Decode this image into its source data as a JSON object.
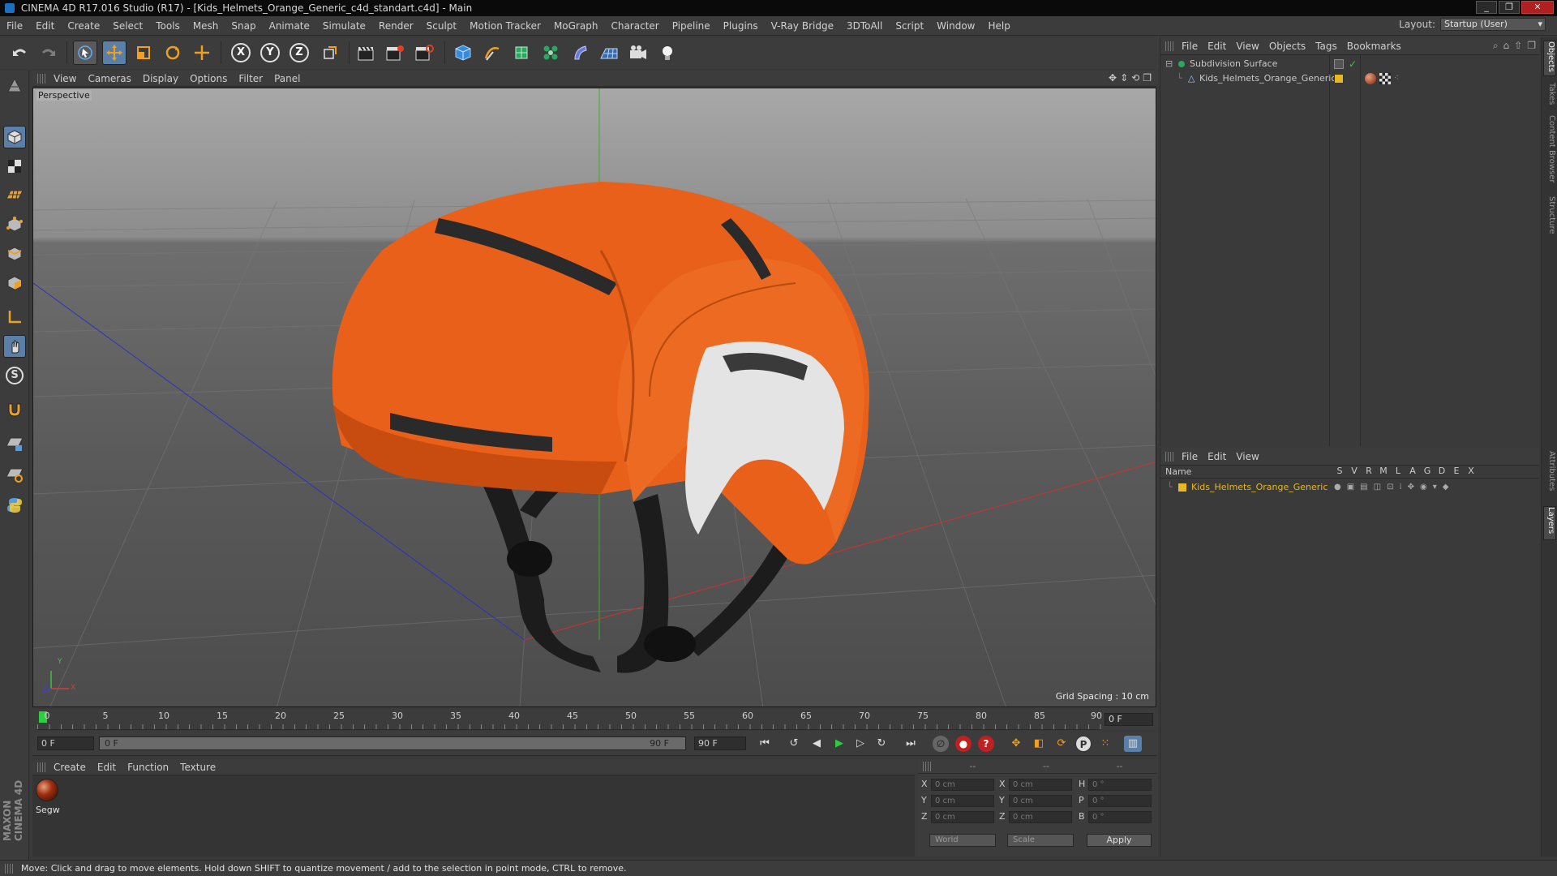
{
  "window": {
    "title": "CINEMA 4D R17.016 Studio (R17) - [Kids_Helmets_Orange_Generic_c4d_standart.c4d] - Main",
    "minimize": "_",
    "restore": "❐",
    "close": "✕"
  },
  "menu": {
    "items": [
      "File",
      "Edit",
      "Create",
      "Select",
      "Tools",
      "Mesh",
      "Snap",
      "Animate",
      "Simulate",
      "Render",
      "Sculpt",
      "Motion Tracker",
      "MoGraph",
      "Character",
      "Pipeline",
      "Plugins",
      "V-Ray Bridge",
      "3DToAll",
      "Script",
      "Window",
      "Help"
    ],
    "layout_label": "Layout:",
    "layout_value": "Startup (User)"
  },
  "toolbar": {
    "axis_x": "X",
    "axis_y": "Y",
    "axis_z": "Z"
  },
  "left_toolbar": {
    "sculpt_s": "S"
  },
  "branding": {
    "logo_text": "MAXON CINEMA 4D"
  },
  "viewport": {
    "menu": [
      "View",
      "Cameras",
      "Display",
      "Options",
      "Filter",
      "Panel"
    ],
    "label": "Perspective",
    "grid_spacing": "Grid Spacing : 10 cm",
    "axis_y": "Y",
    "axis_x": "X",
    "axis_z": "Z"
  },
  "timeline": {
    "ticks": [
      "0",
      "5",
      "10",
      "15",
      "20",
      "25",
      "30",
      "35",
      "40",
      "45",
      "50",
      "55",
      "60",
      "65",
      "70",
      "75",
      "80",
      "85",
      "90"
    ],
    "current_frame": "0 F"
  },
  "transport": {
    "start_field": "0 F",
    "range_start": "0 F",
    "range_end": "90 F",
    "end_field": "90 F"
  },
  "materials": {
    "menu": [
      "Create",
      "Edit",
      "Function",
      "Texture"
    ],
    "items": [
      {
        "name": "Segw"
      }
    ]
  },
  "coordinates": {
    "headers": [
      "--",
      "--",
      "--"
    ],
    "rows": [
      {
        "a": "X",
        "av": "0 cm",
        "b": "X",
        "bv": "0 cm",
        "c": "H",
        "cv": "0 °"
      },
      {
        "a": "Y",
        "av": "0 cm",
        "b": "Y",
        "bv": "0 cm",
        "c": "P",
        "cv": "0 °"
      },
      {
        "a": "Z",
        "av": "0 cm",
        "b": "Z",
        "bv": "0 cm",
        "c": "B",
        "cv": "0 °"
      }
    ],
    "space": "World",
    "mode": "Scale",
    "apply": "Apply"
  },
  "object_manager": {
    "menu": [
      "File",
      "Edit",
      "View",
      "Objects",
      "Tags",
      "Bookmarks"
    ],
    "objects": [
      {
        "name": "Subdivision Surface",
        "color": "#e0e0e0"
      },
      {
        "name": "Kids_Helmets_Orange_Generic",
        "color": "#e0e0e0"
      }
    ]
  },
  "layer_manager": {
    "menu": [
      "File",
      "Edit",
      "View"
    ],
    "header_name": "Name",
    "columns": [
      "S",
      "V",
      "R",
      "M",
      "L",
      "A",
      "G",
      "D",
      "E",
      "X"
    ],
    "layers": [
      {
        "name": "Kids_Helmets_Orange_Generic",
        "color": "#e8b820"
      }
    ]
  },
  "right_tabs": [
    "Objects",
    "Takes",
    "Content Browser",
    "Structure",
    "Attributes",
    "Layers"
  ],
  "status": "Move: Click and drag to move elements. Hold down SHIFT to quantize movement / add to the selection in point mode, CTRL to remove.",
  "colors": {
    "helmet": "#e8601a",
    "accent": "#5a7fa8",
    "layer_yellow": "#e8b820"
  }
}
